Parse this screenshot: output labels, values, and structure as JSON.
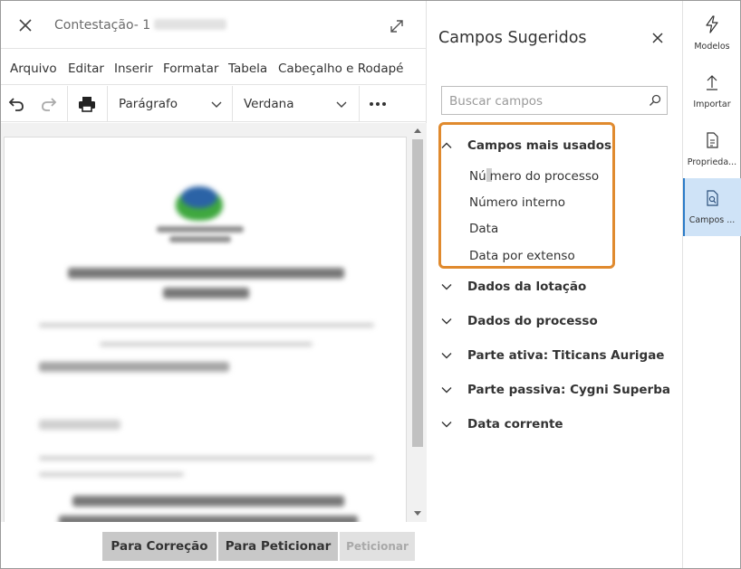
{
  "editor": {
    "title": "Contestação- 1",
    "menu": [
      "Arquivo",
      "Editar",
      "Inserir",
      "Formatar",
      "Tabela",
      "Cabeçalho e Rodapé"
    ],
    "toolbar": {
      "paragraph_style": "Parágrafo",
      "font_family": "Verdana"
    },
    "footer": {
      "correction_button": "Para Correção",
      "file_button": "Para Peticionar",
      "file_disabled_button": "Peticionar"
    }
  },
  "panel": {
    "title": "Campos Sugeridos",
    "search_placeholder": "Buscar campos",
    "groups": [
      {
        "label": "Campos mais usados",
        "expanded": true,
        "items": [
          "Número do processo",
          "Número interno",
          "Data",
          "Data por extenso"
        ]
      },
      {
        "label": "Dados da lotação",
        "expanded": false
      },
      {
        "label": "Dados do processo",
        "expanded": false
      },
      {
        "label": "Parte ativa: Titicans Aurigae",
        "expanded": false
      },
      {
        "label": "Parte passiva: Cygni Superba",
        "expanded": false
      },
      {
        "label": "Data corrente",
        "expanded": false
      }
    ],
    "highlight_color": "#e08a2e",
    "cursor_split": {
      "before": "Nú",
      "after": "mero do processo"
    }
  },
  "rail": {
    "items": [
      {
        "label": "Modelos",
        "icon": "lightning-icon",
        "active": false
      },
      {
        "label": "Importar",
        "icon": "upload-icon",
        "active": false
      },
      {
        "label": "Proprieda...",
        "icon": "document-properties-icon",
        "active": false
      },
      {
        "label": "Campos ...",
        "icon": "document-search-icon",
        "active": true
      }
    ],
    "active_color": "#cfe3f7"
  }
}
